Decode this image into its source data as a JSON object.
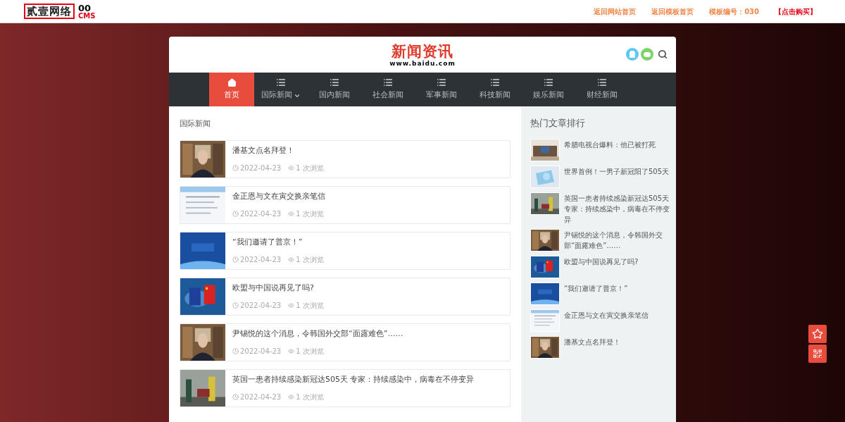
{
  "topbar": {
    "logo": {
      "mark": "贰壹网络",
      "number": "00",
      "sub": "CMS"
    },
    "links": [
      {
        "label": "返回网站首页",
        "kind": "normal"
      },
      {
        "label": "返回模板首页",
        "kind": "normal"
      },
      {
        "label": "模板编号：030",
        "kind": "normal"
      },
      {
        "label": "【点击购买】",
        "kind": "buy"
      }
    ]
  },
  "header": {
    "title": "新闻资讯",
    "domain": "www.baidu.com"
  },
  "nav": [
    {
      "label": "首页",
      "kind": "home",
      "selected": true,
      "dropdown": false
    },
    {
      "label": "国际新闻",
      "kind": "list",
      "selected": false,
      "dropdown": true
    },
    {
      "label": "国内新闻",
      "kind": "list",
      "selected": false,
      "dropdown": false
    },
    {
      "label": "社会新闻",
      "kind": "list",
      "selected": false,
      "dropdown": false
    },
    {
      "label": "军事新闻",
      "kind": "list",
      "selected": false,
      "dropdown": false
    },
    {
      "label": "科技新闻",
      "kind": "list",
      "selected": false,
      "dropdown": false
    },
    {
      "label": "娱乐新闻",
      "kind": "list",
      "selected": false,
      "dropdown": false
    },
    {
      "label": "财经新闻",
      "kind": "list",
      "selected": false,
      "dropdown": false
    }
  ],
  "section_title": "国际新闻",
  "articles": [
    {
      "title": "潘基文点名拜登！",
      "date": "2022-04-23",
      "views": "1 次浏览"
    },
    {
      "title": "金正恩与文在寅交换亲笔信",
      "date": "2022-04-23",
      "views": "1 次浏览"
    },
    {
      "title": "“我们邀请了普京！”",
      "date": "2022-04-23",
      "views": "1 次浏览"
    },
    {
      "title": "欧盟与中国说再见了吗?",
      "date": "2022-04-23",
      "views": "1 次浏览"
    },
    {
      "title": "尹锡悦的这个消息，令韩国外交部“面露难色”……",
      "date": "2022-04-23",
      "views": "1 次浏览"
    },
    {
      "title": "英国一患者持续感染新冠达505天 专家：持续感染中，病毒在不停变异",
      "date": "2022-04-23",
      "views": "1 次浏览"
    }
  ],
  "sidebar": {
    "title": "热门文章排行",
    "items": [
      {
        "title": "希腊电视台爆料：他已被打死"
      },
      {
        "title": "世界首例！一男子新冠阳了505天"
      },
      {
        "title": "英国一患者持续感染新冠达505天专家：持续感染中，病毒在不停变异"
      },
      {
        "title": "尹锡悦的这个消息，令韩国外交部“面露难色”……"
      },
      {
        "title": "欧盟与中国说再见了吗?"
      },
      {
        "title": "“我们邀请了普京！”"
      },
      {
        "title": "金正恩与文在寅交换亲笔信"
      },
      {
        "title": "潘基文点名拜登！"
      }
    ]
  }
}
